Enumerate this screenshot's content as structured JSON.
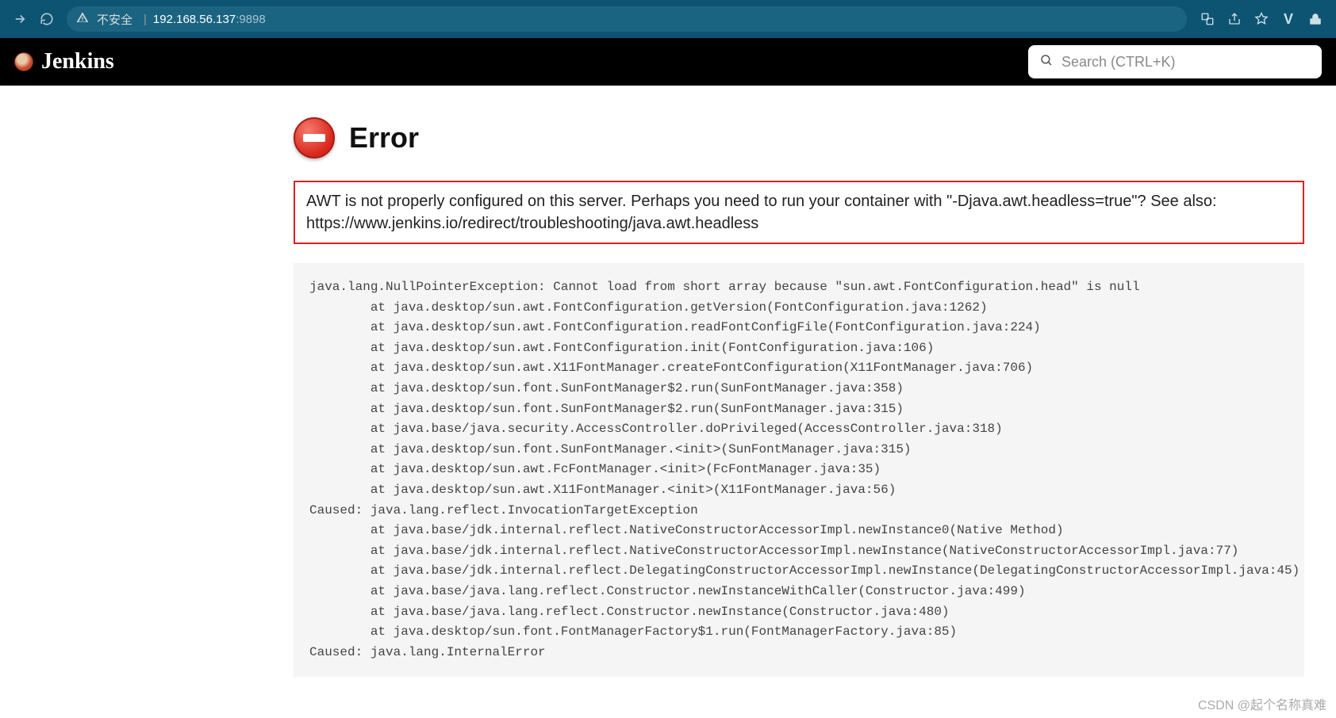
{
  "browser": {
    "insecure_label": "不安全",
    "url_host": "192.168.56.137",
    "url_port": ":9898"
  },
  "header": {
    "brand": "Jenkins",
    "search_placeholder": "Search (CTRL+K)"
  },
  "error": {
    "title": "Error",
    "message": "AWT is not properly configured on this server. Perhaps you need to run your container with \"-Djava.awt.headless=true\"? See also: https://www.jenkins.io/redirect/troubleshooting/java.awt.headless",
    "stack": "java.lang.NullPointerException: Cannot load from short array because \"sun.awt.FontConfiguration.head\" is null\n        at java.desktop/sun.awt.FontConfiguration.getVersion(FontConfiguration.java:1262)\n        at java.desktop/sun.awt.FontConfiguration.readFontConfigFile(FontConfiguration.java:224)\n        at java.desktop/sun.awt.FontConfiguration.init(FontConfiguration.java:106)\n        at java.desktop/sun.awt.X11FontManager.createFontConfiguration(X11FontManager.java:706)\n        at java.desktop/sun.font.SunFontManager$2.run(SunFontManager.java:358)\n        at java.desktop/sun.font.SunFontManager$2.run(SunFontManager.java:315)\n        at java.base/java.security.AccessController.doPrivileged(AccessController.java:318)\n        at java.desktop/sun.font.SunFontManager.<init>(SunFontManager.java:315)\n        at java.desktop/sun.awt.FcFontManager.<init>(FcFontManager.java:35)\n        at java.desktop/sun.awt.X11FontManager.<init>(X11FontManager.java:56)\nCaused: java.lang.reflect.InvocationTargetException\n        at java.base/jdk.internal.reflect.NativeConstructorAccessorImpl.newInstance0(Native Method)\n        at java.base/jdk.internal.reflect.NativeConstructorAccessorImpl.newInstance(NativeConstructorAccessorImpl.java:77)\n        at java.base/jdk.internal.reflect.DelegatingConstructorAccessorImpl.newInstance(DelegatingConstructorAccessorImpl.java:45)\n        at java.base/java.lang.reflect.Constructor.newInstanceWithCaller(Constructor.java:499)\n        at java.base/java.lang.reflect.Constructor.newInstance(Constructor.java:480)\n        at java.desktop/sun.font.FontManagerFactory$1.run(FontManagerFactory.java:85)\nCaused: java.lang.InternalError"
  },
  "watermark": "CSDN @起个名称真难"
}
